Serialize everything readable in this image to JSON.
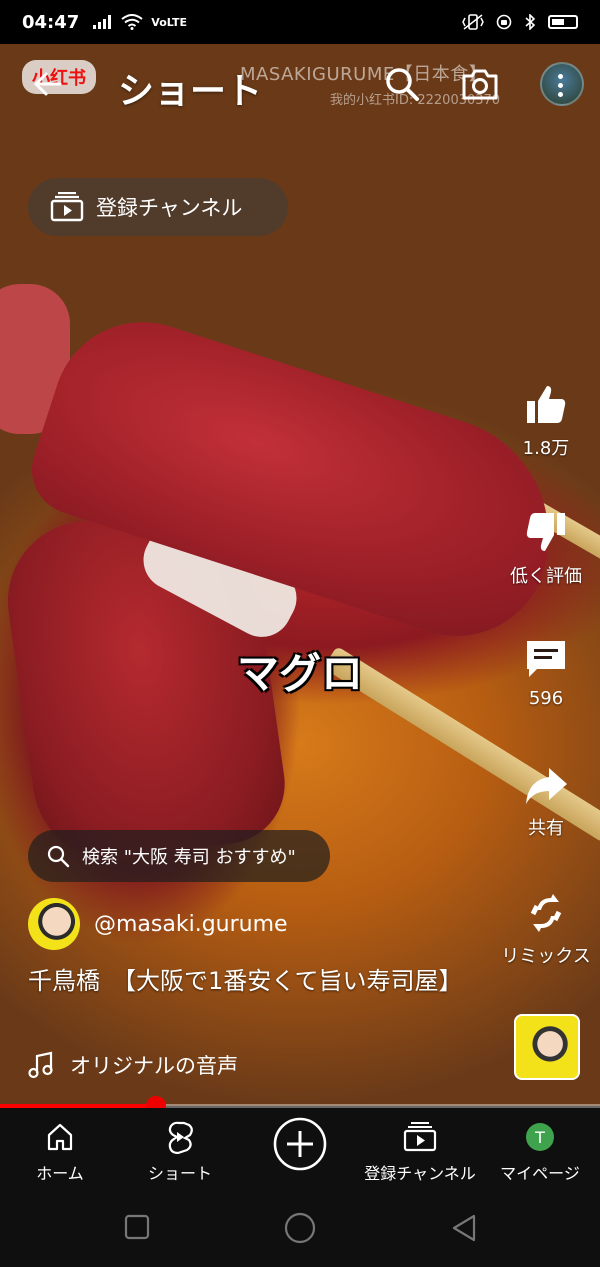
{
  "status_bar": {
    "time": "04:47",
    "network": "VoLTE"
  },
  "header": {
    "title": "ショート"
  },
  "video": {
    "watermark_app": "小红书",
    "watermark_title": "MASAKIGURUME【日本食】",
    "watermark_id": "我的小红书ID: 2220030370",
    "overlay_caption": "マグロ"
  },
  "subscriptions_chip": {
    "label": "登録チャンネル"
  },
  "actions": {
    "like": "1.8万",
    "dislike": "低く評価",
    "comments": "596",
    "share": "共有",
    "remix": "リミックス"
  },
  "search_suggestion": {
    "text": "検索 \"大阪 寿司 おすすめ\""
  },
  "channel": {
    "handle": "@masaki.gurume"
  },
  "video_title": "千鳥橋　【大阪で1番安くて旨い寿司屋】",
  "audio": {
    "label": "オリジナルの音声"
  },
  "progress": {
    "fraction": 0.26
  },
  "bottom_nav": {
    "home": "ホーム",
    "shorts": "ショート",
    "subscriptions": "登録チャンネル",
    "you": "マイページ",
    "avatar_letter": "T"
  },
  "colors": {
    "progress": "#ff0000",
    "avatar_bg": "#3fa34d"
  }
}
